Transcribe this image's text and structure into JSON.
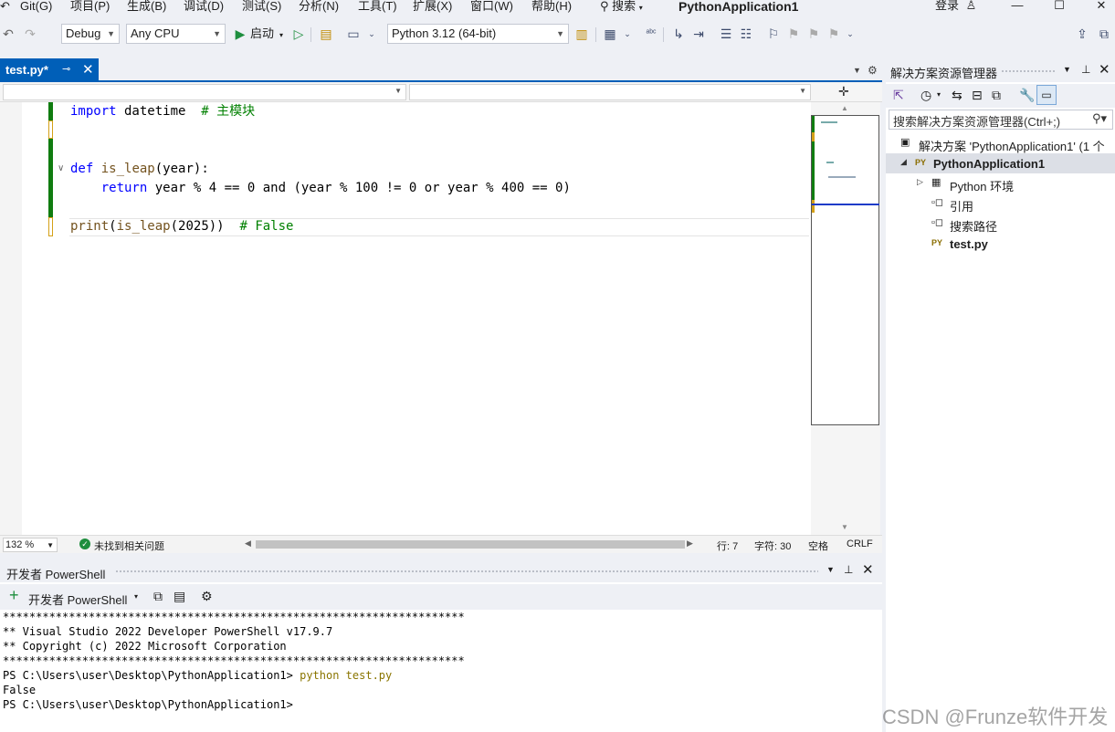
{
  "menu": {
    "items": [
      "Git(G)",
      "项目(P)",
      "生成(B)",
      "调试(D)",
      "测试(S)",
      "分析(N)",
      "工具(T)",
      "扩展(X)",
      "窗口(W)",
      "帮助(H)"
    ],
    "search_label": "搜索",
    "app_title": "PythonApplication1",
    "signin_label": "登录"
  },
  "toolbar": {
    "config": "Debug",
    "platform": "Any CPU",
    "start_label": "启动",
    "interpreter": "Python 3.12 (64-bit)"
  },
  "document_tab": {
    "label": "test.py*"
  },
  "editor": {
    "lines": [
      {
        "tokens": [
          {
            "t": "import",
            "c": "kw"
          },
          {
            "t": " datetime  ",
            "c": ""
          },
          {
            "t": "# 主模块",
            "c": "cm"
          }
        ]
      },
      {
        "tokens": []
      },
      {
        "tokens": []
      },
      {
        "tokens": [
          {
            "t": "def",
            "c": "kw"
          },
          {
            "t": " ",
            "c": ""
          },
          {
            "t": "is_leap",
            "c": "fn"
          },
          {
            "t": "(year):",
            "c": ""
          }
        ]
      },
      {
        "tokens": [
          {
            "t": "    ",
            "c": ""
          },
          {
            "t": "return",
            "c": "kw"
          },
          {
            "t": " year % 4 == 0 and (year % 100 != 0 or year % 400 == 0)",
            "c": ""
          }
        ]
      },
      {
        "tokens": []
      },
      {
        "tokens": [
          {
            "t": "print",
            "c": "fn"
          },
          {
            "t": "(",
            "c": ""
          },
          {
            "t": "is_leap",
            "c": "fn"
          },
          {
            "t": "(2025))  ",
            "c": ""
          },
          {
            "t": "# False",
            "c": "cm"
          }
        ]
      }
    ]
  },
  "status": {
    "zoom": "132 %",
    "issues": "未找到相关问题",
    "line": "行: 7",
    "char": "字符: 30",
    "whitespace": "空格",
    "eol": "CRLF"
  },
  "terminal": {
    "panel_title": "开发者 PowerShell",
    "new_label": "开发者 PowerShell",
    "lines": [
      {
        "text": "**********************************************************************",
        "cmd": ""
      },
      {
        "text": "** Visual Studio 2022 Developer PowerShell v17.9.7",
        "cmd": ""
      },
      {
        "text": "** Copyright (c) 2022 Microsoft Corporation",
        "cmd": ""
      },
      {
        "text": "**********************************************************************",
        "cmd": ""
      },
      {
        "text": "PS C:\\Users\\user\\Desktop\\PythonApplication1> ",
        "cmd": "python test.py"
      },
      {
        "text": "False",
        "cmd": ""
      },
      {
        "text": "PS C:\\Users\\user\\Desktop\\PythonApplication1>",
        "cmd": ""
      }
    ]
  },
  "solution_explorer": {
    "title": "解决方案资源管理器",
    "search_placeholder": "搜索解决方案资源管理器(Ctrl+;)",
    "items": [
      {
        "label": "解决方案 'PythonApplication1' (1 个",
        "icon": "solution-icon",
        "glyph": "▣",
        "indent": 16,
        "bold": false,
        "expander": "",
        "selected": false
      },
      {
        "label": "PythonApplication1",
        "icon": "python-project-icon",
        "glyph": "PY",
        "indent": 32,
        "bold": true,
        "expander": "◢",
        "selected": true
      },
      {
        "label": "Python 环境",
        "icon": "environment-icon",
        "glyph": "▦",
        "indent": 50,
        "bold": false,
        "expander": "▷",
        "selected": false
      },
      {
        "label": "引用",
        "icon": "references-icon",
        "glyph": "▫◻",
        "indent": 50,
        "bold": false,
        "expander": "",
        "selected": false
      },
      {
        "label": "搜索路径",
        "icon": "search-paths-icon",
        "glyph": "▫◻",
        "indent": 50,
        "bold": false,
        "expander": "",
        "selected": false
      },
      {
        "label": "test.py",
        "icon": "python-file-icon",
        "glyph": "PY",
        "indent": 50,
        "bold": true,
        "expander": "",
        "selected": false
      }
    ]
  },
  "watermark": "CSDN @Frunze软件开发",
  "colors": {
    "accent": "#005fb8",
    "keyword": "#0000ff",
    "function": "#74531f",
    "comment": "#008000",
    "saved_change": "#107c10",
    "unsaved_change": "#d4a017"
  }
}
